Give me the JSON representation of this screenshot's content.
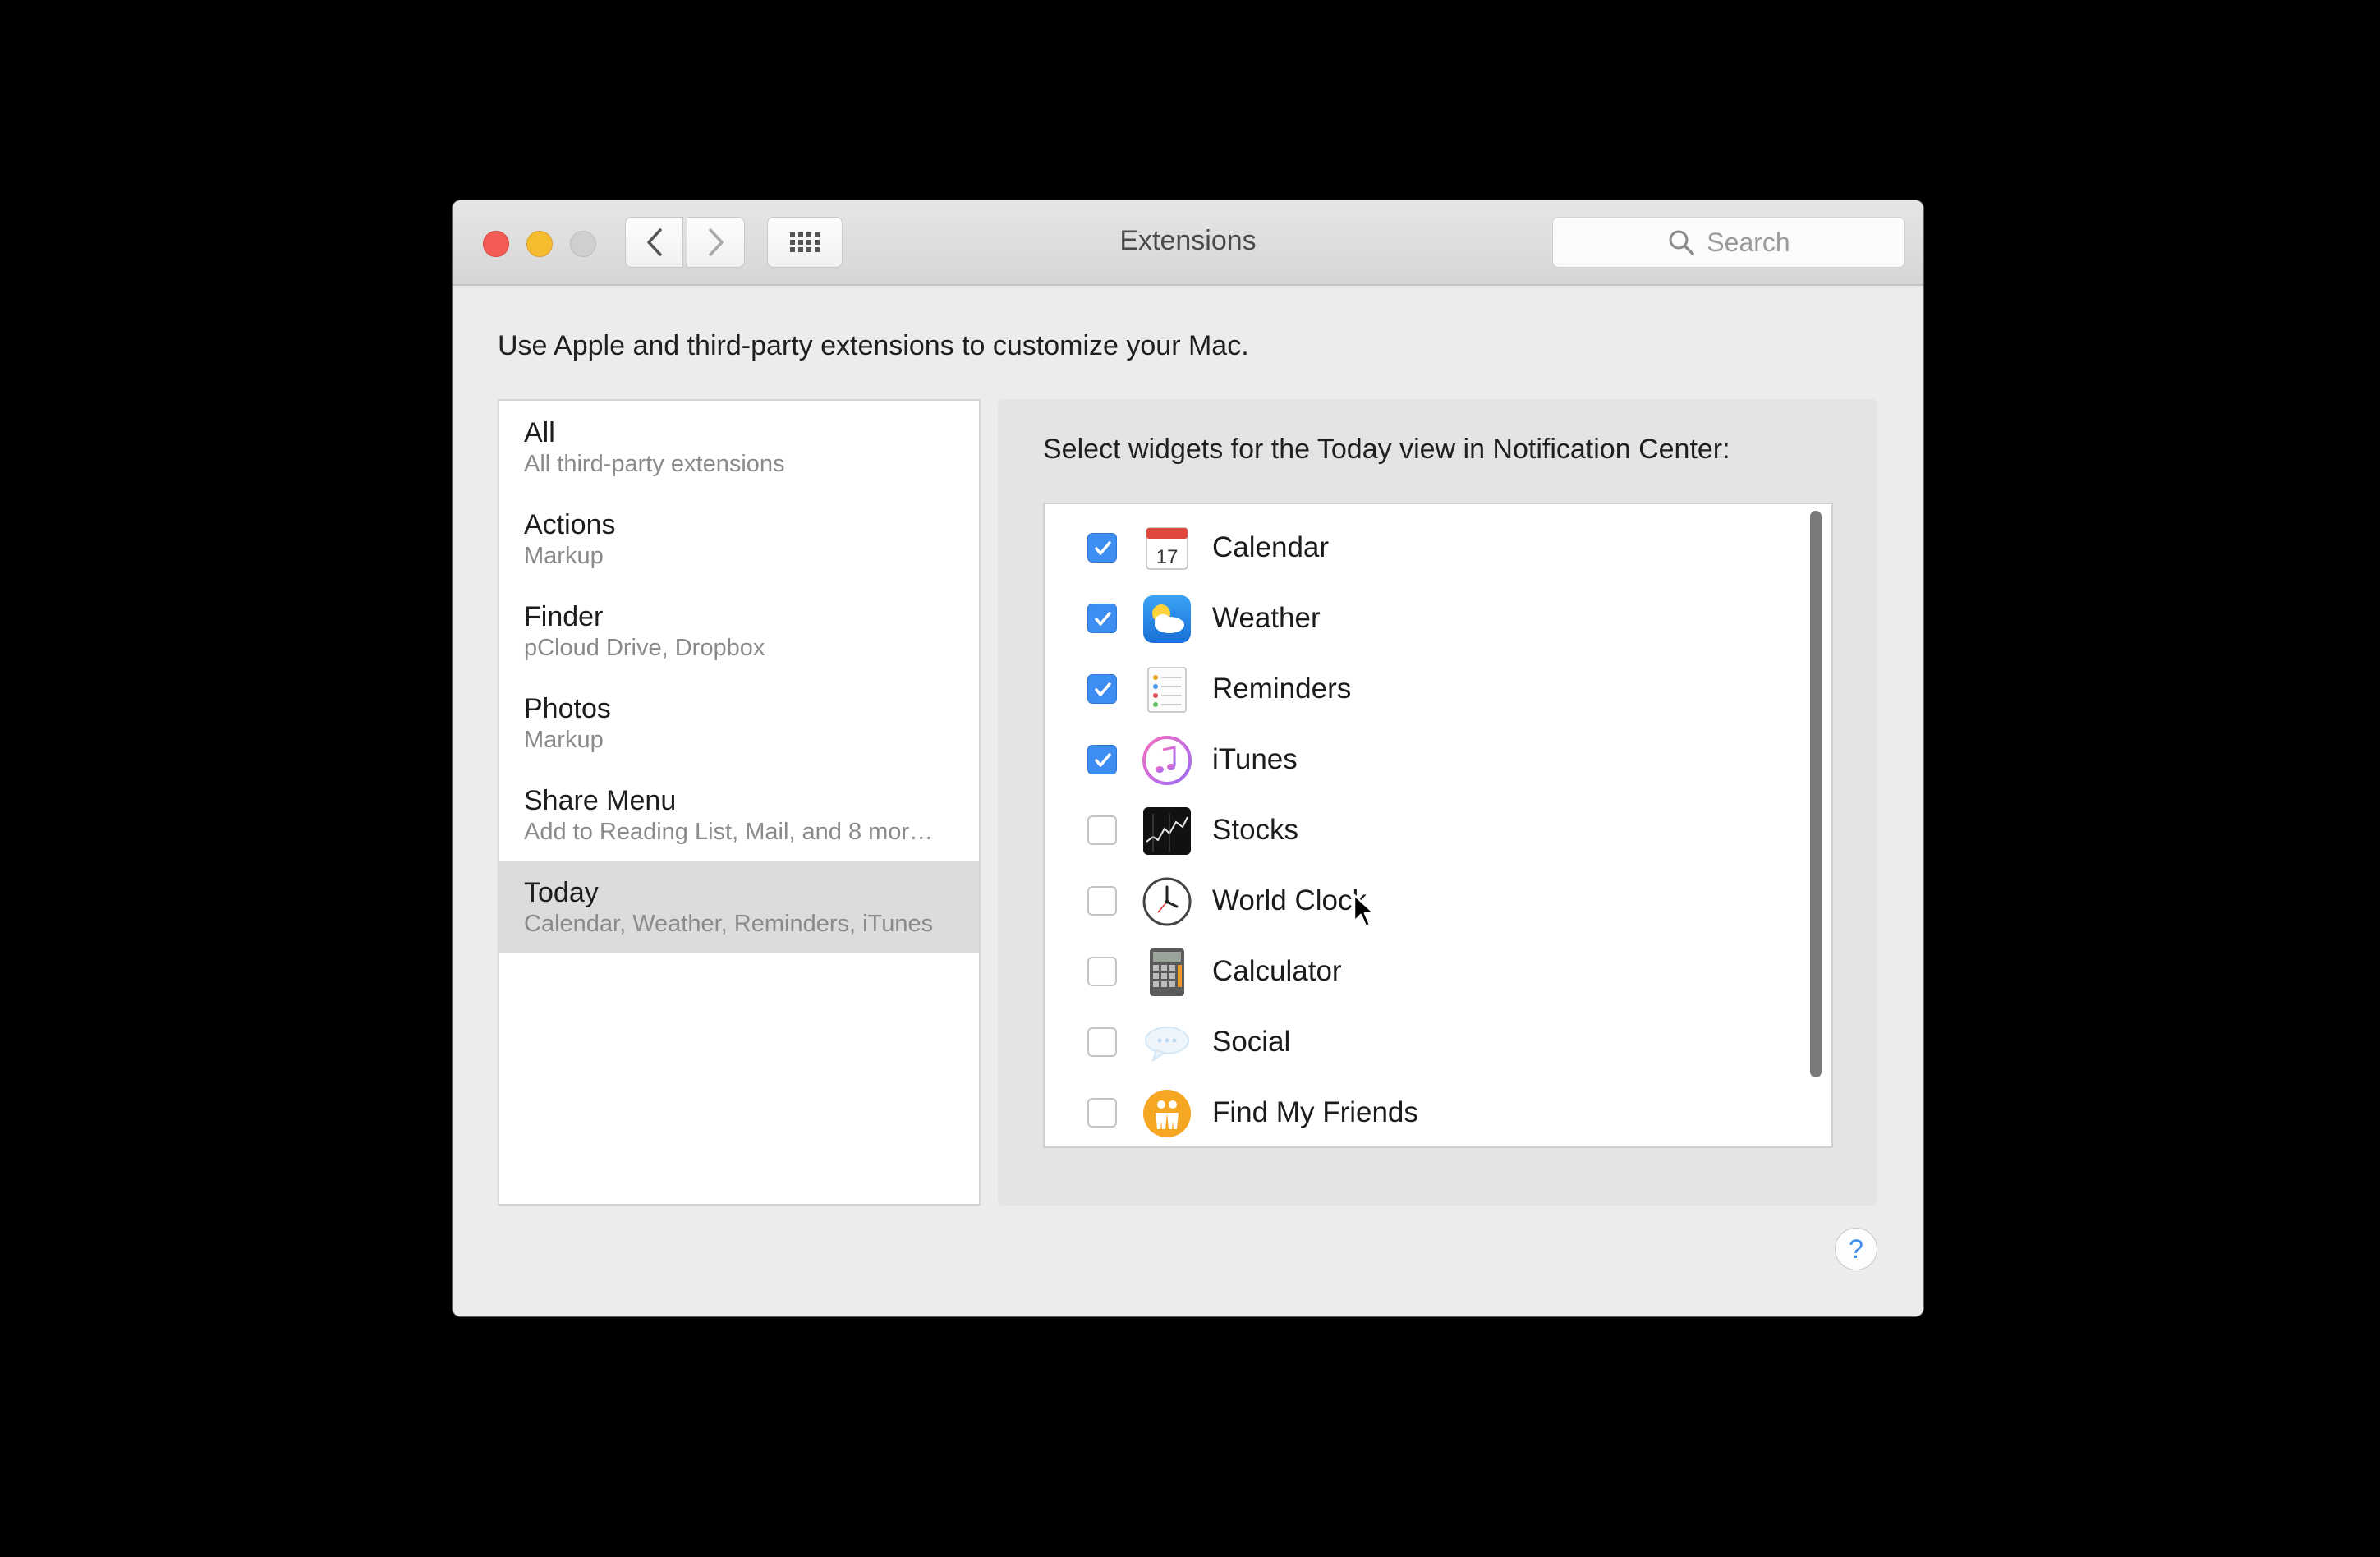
{
  "window": {
    "title": "Extensions",
    "search_placeholder": "Search"
  },
  "intro_text": "Use Apple and third-party extensions to customize your Mac.",
  "sidebar": {
    "items": [
      {
        "title": "All",
        "subtitle": "All third-party extensions",
        "selected": false
      },
      {
        "title": "Actions",
        "subtitle": "Markup",
        "selected": false
      },
      {
        "title": "Finder",
        "subtitle": "pCloud Drive, Dropbox",
        "selected": false
      },
      {
        "title": "Photos",
        "subtitle": "Markup",
        "selected": false
      },
      {
        "title": "Share Menu",
        "subtitle": "Add to Reading List, Mail, and 8 mor…",
        "selected": false
      },
      {
        "title": "Today",
        "subtitle": "Calendar, Weather, Reminders, iTunes",
        "selected": true
      }
    ]
  },
  "today_panel": {
    "heading": "Select widgets for the Today view in Notification Center:",
    "widgets": [
      {
        "name": "Calendar",
        "checked": true,
        "icon": "calendar-icon",
        "icon_text": "17"
      },
      {
        "name": "Weather",
        "checked": true,
        "icon": "weather-icon"
      },
      {
        "name": "Reminders",
        "checked": true,
        "icon": "reminders-icon"
      },
      {
        "name": "iTunes",
        "checked": true,
        "icon": "itunes-icon"
      },
      {
        "name": "Stocks",
        "checked": false,
        "icon": "stocks-icon"
      },
      {
        "name": "World Clock",
        "checked": false,
        "icon": "world-clock-icon"
      },
      {
        "name": "Calculator",
        "checked": false,
        "icon": "calculator-icon"
      },
      {
        "name": "Social",
        "checked": false,
        "icon": "social-icon"
      },
      {
        "name": "Find My Friends",
        "checked": false,
        "icon": "find-my-friends-icon"
      }
    ]
  },
  "help_label": "?",
  "colors": {
    "accent": "#3d8ef0",
    "close": "#f25b56",
    "minimize": "#f6bc2f",
    "zoom_disabled": "#cfcfcf",
    "selection": "#dcdcdc"
  }
}
